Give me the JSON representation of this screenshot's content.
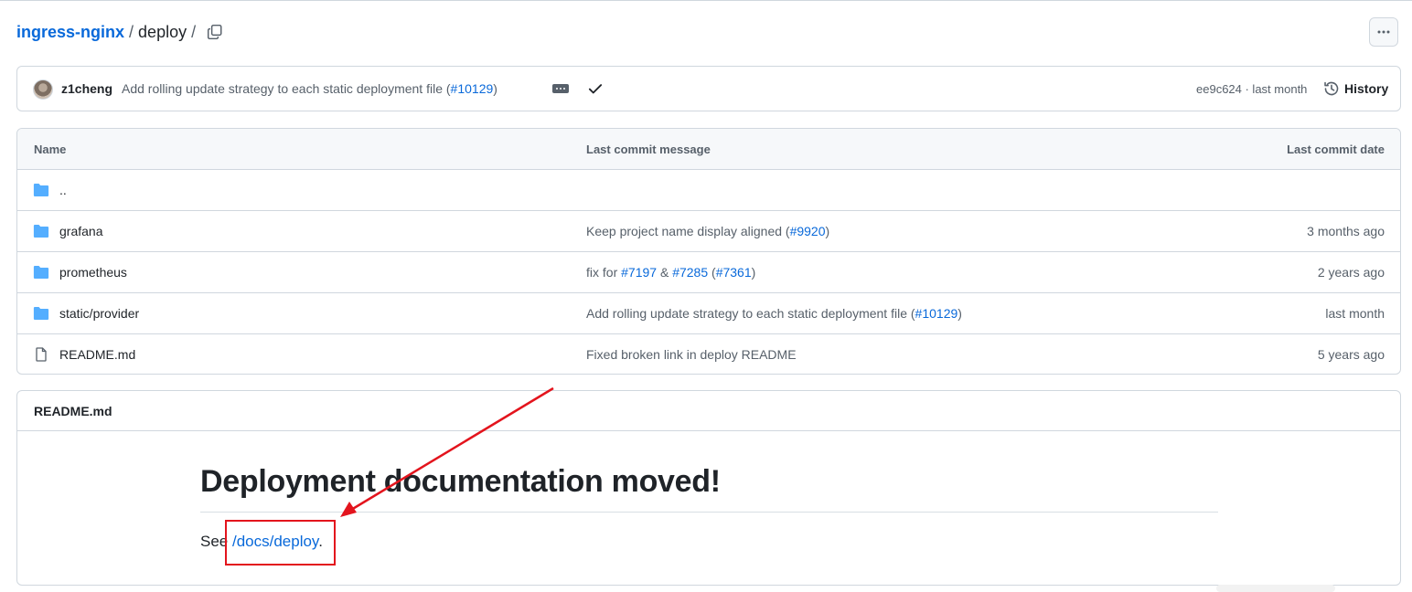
{
  "breadcrumb": {
    "repo": "ingress-nginx",
    "sep1": "/",
    "dir": "deploy",
    "sep2": "/"
  },
  "commit": {
    "author": "z1cheng",
    "message": "Add rolling update strategy to each static deployment file (",
    "pr": "#10129",
    "message_end": ")",
    "sha_time": "ee9c624 · last month",
    "history_label": "History"
  },
  "table": {
    "headers": {
      "name": "Name",
      "message": "Last commit message",
      "date": "Last commit date"
    },
    "rows": [
      {
        "name": "..",
        "type": "dir",
        "msg": [],
        "date": ""
      },
      {
        "name": "grafana",
        "type": "dir",
        "msg": [
          {
            "t": "Keep project name display aligned ("
          },
          {
            "t": "#9920",
            "link": true
          },
          {
            "t": ")"
          }
        ],
        "date": "3 months ago"
      },
      {
        "name": "prometheus",
        "type": "dir",
        "msg": [
          {
            "t": "fix for "
          },
          {
            "t": "#7197",
            "link": true
          },
          {
            "t": " & "
          },
          {
            "t": "#7285",
            "link": true
          },
          {
            "t": " ("
          },
          {
            "t": "#7361",
            "link": true
          },
          {
            "t": ")"
          }
        ],
        "date": "2 years ago"
      },
      {
        "name": "static/provider",
        "type": "dir",
        "msg": [
          {
            "t": "Add rolling update strategy to each static deployment file ("
          },
          {
            "t": "#10129",
            "link": true
          },
          {
            "t": ")"
          }
        ],
        "date": "last month"
      },
      {
        "name": "README.md",
        "type": "file",
        "msg": [
          {
            "t": "Fixed broken link in deploy README"
          }
        ],
        "date": "5 years ago"
      }
    ]
  },
  "readme": {
    "title": "README.md",
    "heading": "Deployment documentation moved!",
    "see": "See ",
    "link": "/docs/deploy",
    "period": "."
  },
  "colors": {
    "accent": "#0969da",
    "folder": "#54aeff",
    "annotation": "#e3141d",
    "border": "#d0d7de"
  }
}
